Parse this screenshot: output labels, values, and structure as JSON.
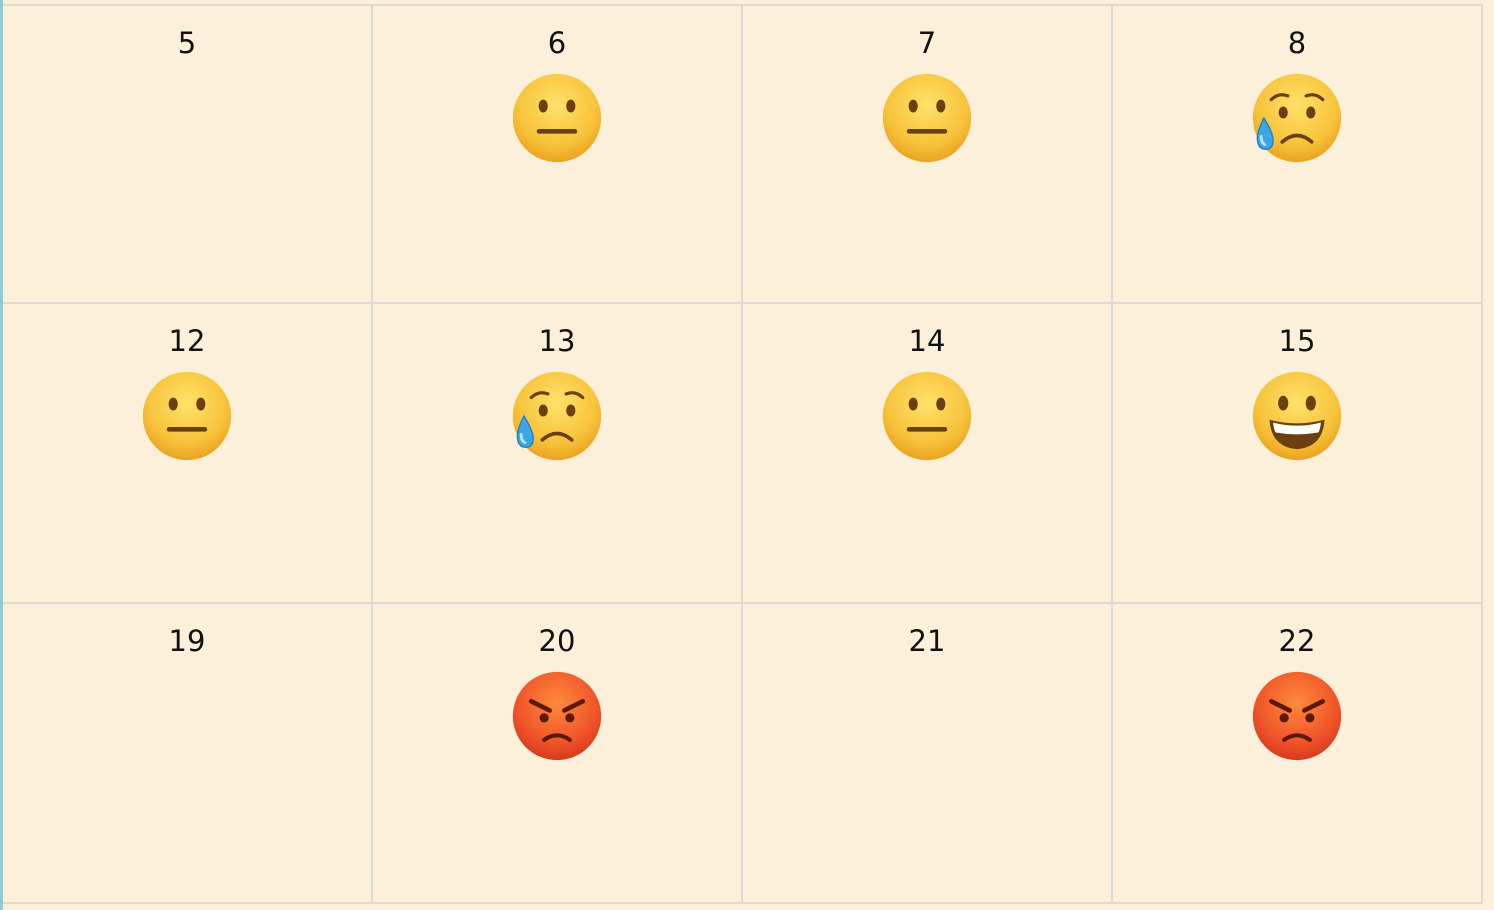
{
  "calendar": {
    "weeks": [
      {
        "days": [
          {
            "day": "5",
            "mood": null
          },
          {
            "day": "6",
            "mood": "neutral-face-icon"
          },
          {
            "day": "7",
            "mood": "neutral-face-icon"
          },
          {
            "day": "8",
            "mood": "sad-sweat-face-icon"
          }
        ]
      },
      {
        "days": [
          {
            "day": "12",
            "mood": "neutral-face-icon"
          },
          {
            "day": "13",
            "mood": "sad-sweat-face-icon"
          },
          {
            "day": "14",
            "mood": "neutral-face-icon"
          },
          {
            "day": "15",
            "mood": "grinning-face-icon"
          }
        ]
      },
      {
        "days": [
          {
            "day": "19",
            "mood": null
          },
          {
            "day": "20",
            "mood": "angry-face-icon"
          },
          {
            "day": "21",
            "mood": null
          },
          {
            "day": "22",
            "mood": "angry-face-icon"
          }
        ]
      }
    ]
  },
  "colors": {
    "background": "#fcf0da",
    "gridline": "#dcdcd6",
    "left_edge": "#8ecbd8",
    "face_yellow": "#f7c23a",
    "face_angry": "#f0542a"
  }
}
